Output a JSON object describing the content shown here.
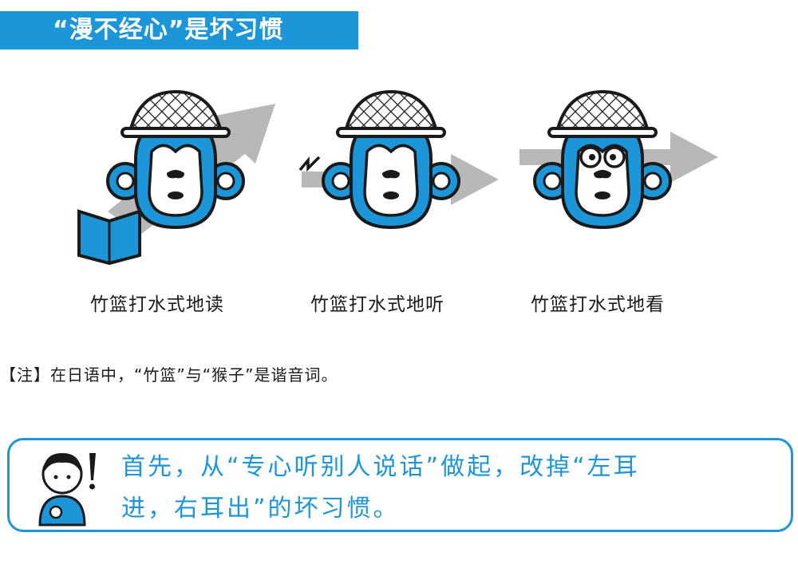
{
  "header": {
    "title": "“漫不经心”是坏习惯"
  },
  "figures": [
    {
      "caption": "竹篮打水式地读",
      "icon": "open-book-icon"
    },
    {
      "caption": "竹篮打水式地听",
      "icon": "sound-wave-icon"
    },
    {
      "caption": "竹篮打水式地看",
      "icon": "glasses-icon"
    }
  ],
  "note": {
    "text": "【注】在日语中，“竹篮”与“猴子”是谐音词。"
  },
  "callout": {
    "line1": "首先，从“专心听别人说话”做起，改掉“左耳",
    "line2": "进，右耳出”的坏习惯。"
  },
  "colors": {
    "accent": "#1c96d8",
    "arrow": "#b8b8b8",
    "ink": "#1a1a1a"
  }
}
